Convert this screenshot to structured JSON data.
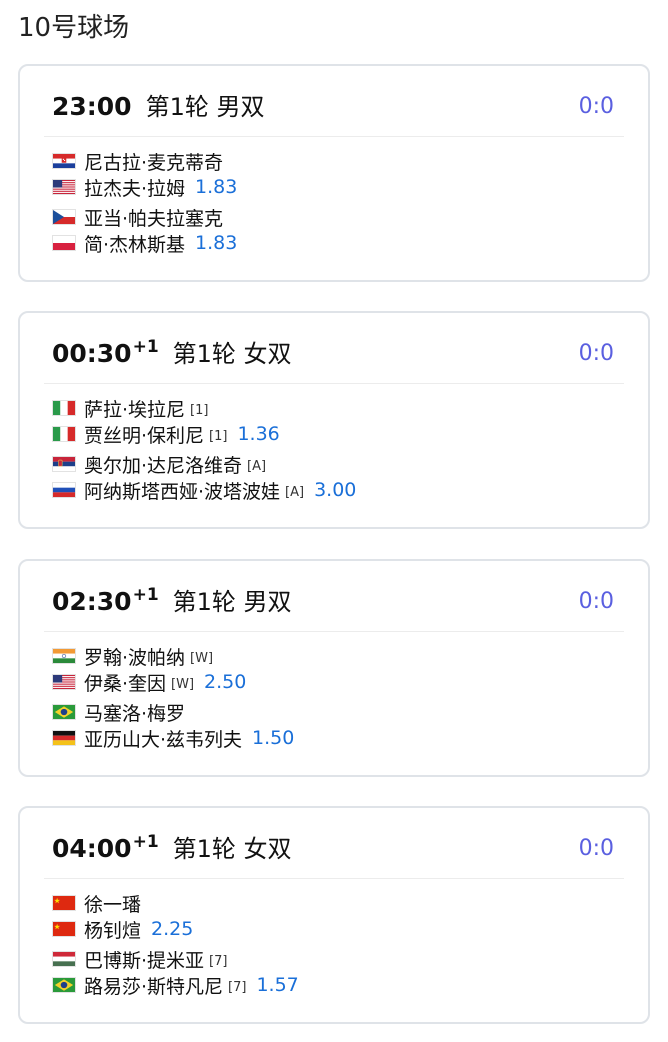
{
  "page": {
    "title": "10号球场"
  },
  "matches": [
    {
      "time": "23:00",
      "day_offset": "",
      "round": "第1轮 男双",
      "score": "0:0",
      "players": [
        {
          "flag": "croatia",
          "name": "尼古拉·麦克蒂奇",
          "seed": "",
          "odds": ""
        },
        {
          "flag": "usa",
          "name": "拉杰夫·拉姆",
          "seed": "",
          "odds": "1.83"
        },
        {
          "flag": "czech",
          "name": "亚当·帕夫拉塞克",
          "seed": "",
          "odds": ""
        },
        {
          "flag": "poland",
          "name": "简·杰林斯基",
          "seed": "",
          "odds": "1.83"
        }
      ]
    },
    {
      "time": "00:30",
      "day_offset": "+1",
      "round": "第1轮 女双",
      "score": "0:0",
      "players": [
        {
          "flag": "italy",
          "name": "萨拉·埃拉尼",
          "seed": "[1]",
          "odds": ""
        },
        {
          "flag": "italy",
          "name": "贾丝明·保利尼",
          "seed": "[1]",
          "odds": "1.36"
        },
        {
          "flag": "serbia",
          "name": "奥尔加·达尼洛维奇",
          "seed": "[A]",
          "odds": ""
        },
        {
          "flag": "russia",
          "name": "阿纳斯塔西娅·波塔波娃",
          "seed": "[A]",
          "odds": "3.00"
        }
      ]
    },
    {
      "time": "02:30",
      "day_offset": "+1",
      "round": "第1轮 男双",
      "score": "0:0",
      "players": [
        {
          "flag": "india",
          "name": "罗翰·波帕纳",
          "seed": "[W]",
          "odds": ""
        },
        {
          "flag": "usa",
          "name": "伊桑·奎因",
          "seed": "[W]",
          "odds": "2.50"
        },
        {
          "flag": "brazil",
          "name": "马塞洛·梅罗",
          "seed": "",
          "odds": ""
        },
        {
          "flag": "germany",
          "name": "亚历山大·兹韦列夫",
          "seed": "",
          "odds": "1.50"
        }
      ]
    },
    {
      "time": "04:00",
      "day_offset": "+1",
      "round": "第1轮 女双",
      "score": "0:0",
      "players": [
        {
          "flag": "china",
          "name": "徐一璠",
          "seed": "",
          "odds": ""
        },
        {
          "flag": "china",
          "name": "杨钊煊",
          "seed": "",
          "odds": "2.25"
        },
        {
          "flag": "hungary",
          "name": "巴博斯·提米亚",
          "seed": "[7]",
          "odds": ""
        },
        {
          "flag": "brazil",
          "name": "路易莎·斯特凡尼",
          "seed": "[7]",
          "odds": "1.57"
        }
      ]
    }
  ]
}
